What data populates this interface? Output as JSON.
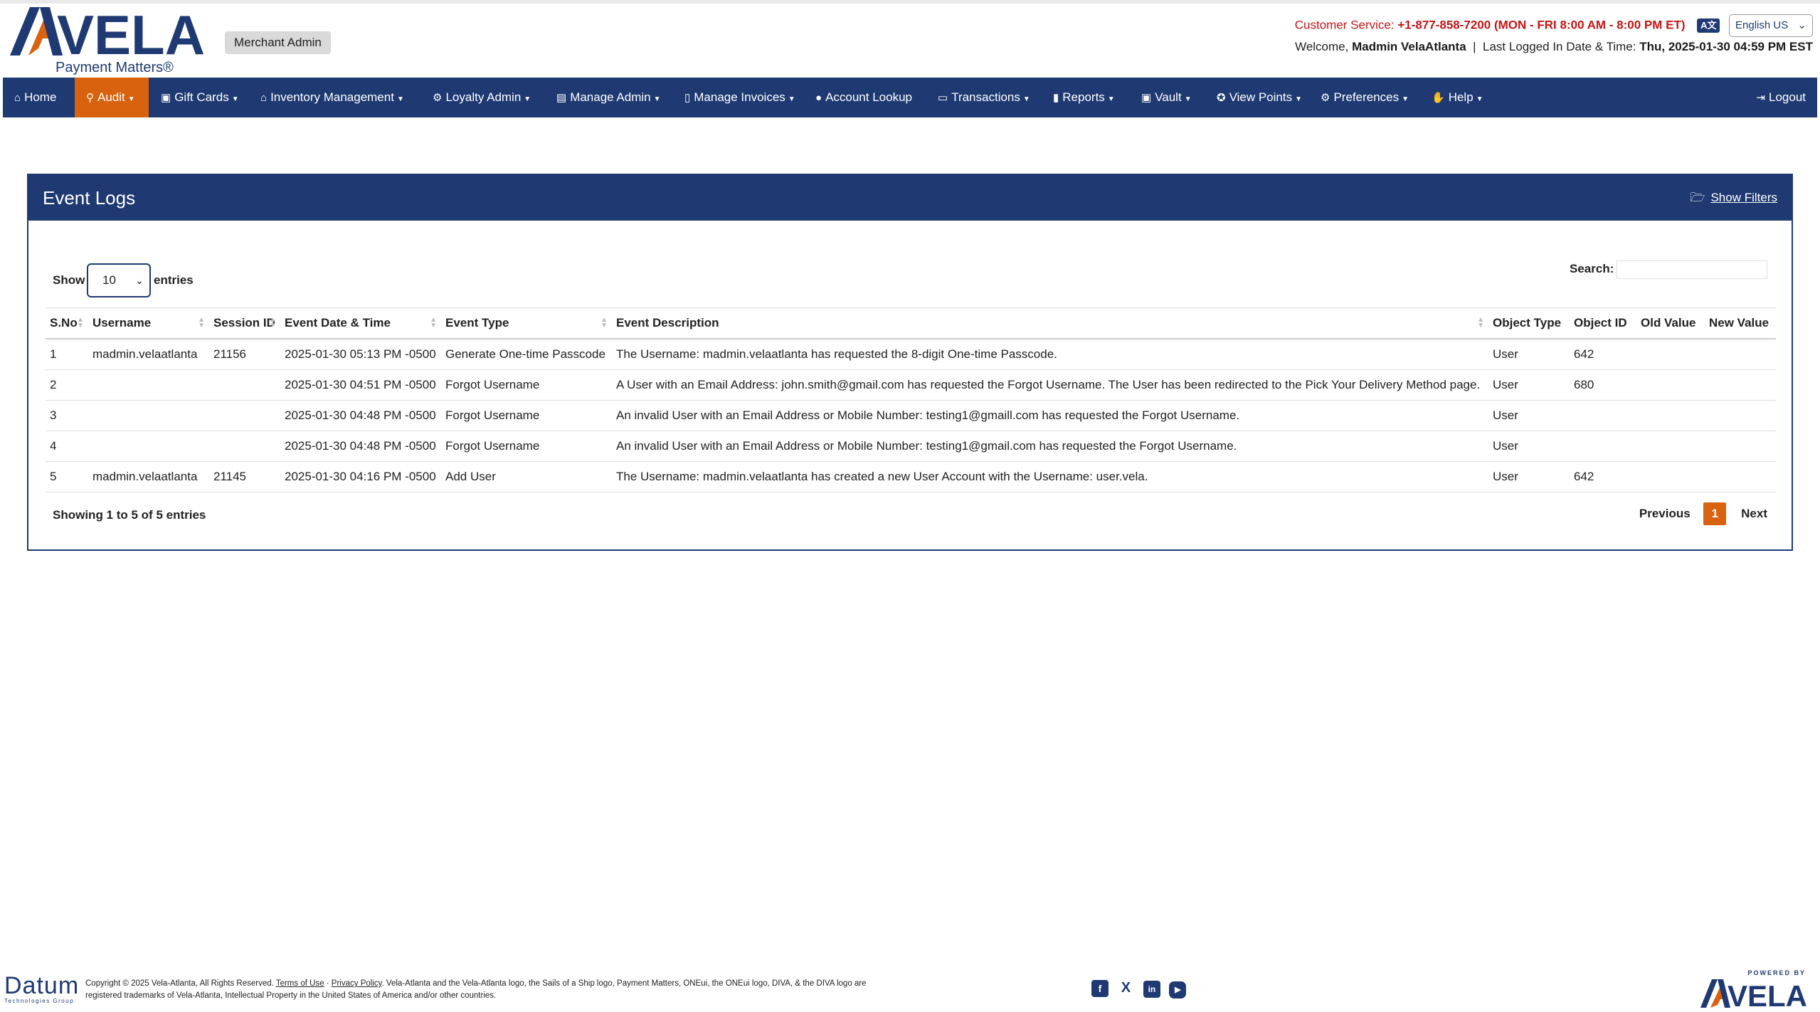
{
  "header": {
    "logo_text": "VELA",
    "logo_tagline": "Payment Matters®",
    "badge": "Merchant Admin",
    "customer_service_label": "Customer Service:",
    "customer_service_value": "+1-877-858-7200 (MON - FRI 8:00 AM - 8:00 PM ET)",
    "language_icon": "translate-icon",
    "language": "English US",
    "welcome_label": "Welcome,",
    "user_name": "Madmin VelaAtlanta",
    "separator": "|",
    "last_logged_label": "Last Logged In Date & Time:",
    "last_logged_value": "Thu, 2025-01-30 04:59 PM EST"
  },
  "nav": {
    "items": [
      {
        "label": "Home",
        "icon": "home-icon",
        "caret": false
      },
      {
        "label": "Audit",
        "icon": "magnifier-icon",
        "caret": true,
        "active": true
      },
      {
        "label": "Gift Cards",
        "icon": "gift-icon",
        "caret": true
      },
      {
        "label": "Inventory Management",
        "icon": "warehouse-icon",
        "caret": true
      },
      {
        "label": "Loyalty Admin",
        "icon": "gears-icon",
        "caret": true
      },
      {
        "label": "Manage Admin",
        "icon": "building-icon",
        "caret": true
      },
      {
        "label": "Manage Invoices",
        "icon": "invoice-icon",
        "caret": true
      },
      {
        "label": "Account Lookup",
        "icon": "user-icon",
        "caret": false
      },
      {
        "label": "Transactions",
        "icon": "money-icon",
        "caret": true
      },
      {
        "label": "Reports",
        "icon": "bar-chart-icon",
        "caret": true
      },
      {
        "label": "Vault",
        "icon": "vault-icon",
        "caret": true
      },
      {
        "label": "View Points",
        "icon": "award-icon",
        "caret": true
      },
      {
        "label": "Preferences",
        "icon": "gear-icon",
        "caret": true
      },
      {
        "label": "Help",
        "icon": "lifebuoy-icon",
        "caret": true
      }
    ],
    "logout": "Logout"
  },
  "panel": {
    "title": "Event Logs",
    "show_filters": "Show Filters",
    "show_label": "Show",
    "page_size": "10",
    "entries_label": "entries",
    "search_label": "Search:",
    "search_value": "",
    "columns": [
      "S.No",
      "Username",
      "Session ID",
      "Event Date & Time",
      "Event Type",
      "Event Description",
      "Object Type",
      "Object ID",
      "Old Value",
      "New Value"
    ],
    "rows": [
      [
        "1",
        "madmin.velaatlanta",
        "21156",
        "2025-01-30 05:13 PM -0500",
        "Generate One-time Passcode",
        "The Username: madmin.velaatlanta has requested the 8-digit One-time Passcode.",
        "User",
        "642",
        "",
        ""
      ],
      [
        "2",
        "",
        "",
        "2025-01-30 04:51 PM -0500",
        "Forgot Username",
        "A User with an Email Address: john.smith@gmail.com has requested the Forgot Username. The User has been redirected to the Pick Your Delivery Method page.",
        "User",
        "680",
        "",
        ""
      ],
      [
        "3",
        "",
        "",
        "2025-01-30 04:48 PM -0500",
        "Forgot Username",
        "An invalid User with an Email Address or Mobile Number: testing1@gmaill.com has requested the Forgot Username.",
        "User",
        "",
        "",
        ""
      ],
      [
        "4",
        "",
        "",
        "2025-01-30 04:48 PM -0500",
        "Forgot Username",
        "An invalid User with an Email Address or Mobile Number: testing1@gmail.com has requested the Forgot Username.",
        "User",
        "",
        "",
        ""
      ],
      [
        "5",
        "madmin.velaatlanta",
        "21145",
        "2025-01-30 04:16 PM -0500",
        "Add User",
        "The Username: madmin.velaatlanta has created a new User Account with the Username: user.vela.",
        "User",
        "642",
        "",
        ""
      ]
    ],
    "showing": "Showing 1 to 5 of 5 entries",
    "pager": {
      "previous": "Previous",
      "current": "1",
      "next": "Next"
    }
  },
  "footer": {
    "company": "Datum",
    "company_sub": "Technologies Group",
    "copyright": "Copyright © 2025 Vela-Atlanta, All Rights Reserved.",
    "terms": "Terms of Use",
    "privacy": "Privacy Policy",
    "trademark": "Vela-Atlanta and the Vela-Atlanta logo, the Sails of a Ship logo, Payment Matters, ONEui, the ONEui logo, DIVA, & the DIVA logo are registered trademarks of Vela-Atlanta, Intellectual Property in the United States of America and/or other countries.",
    "social": [
      {
        "icon": "facebook-icon",
        "glyph": "f"
      },
      {
        "icon": "x-twitter-icon",
        "glyph": "X"
      },
      {
        "icon": "linkedin-icon",
        "glyph": "in"
      },
      {
        "icon": "youtube-icon",
        "glyph": "▶"
      }
    ],
    "powered_by": "POWERED BY",
    "powered_logo": "VELA"
  }
}
